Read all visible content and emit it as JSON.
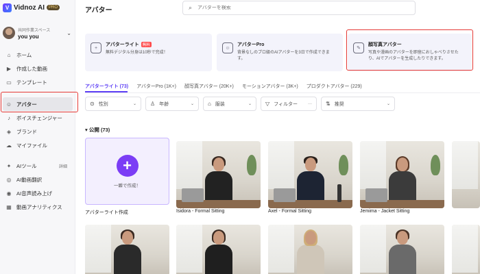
{
  "app": {
    "logo_text": "Vidnoz AI",
    "plan_badge": "PRO"
  },
  "workspace": {
    "label": "共同作業スペース",
    "name": "you you"
  },
  "sidebar": {
    "items": [
      {
        "label": "ホーム",
        "icon": "home-icon"
      },
      {
        "label": "作成した動画",
        "icon": "video-icon"
      },
      {
        "label": "テンプレート",
        "icon": "template-icon"
      },
      {
        "label": "アバター",
        "icon": "avatar-icon",
        "active": true
      },
      {
        "label": "ボイスチェンジャー",
        "icon": "voice-icon"
      },
      {
        "label": "ブランド",
        "icon": "brand-icon"
      },
      {
        "label": "マイファイル",
        "icon": "cloud-icon"
      }
    ],
    "tools": [
      {
        "label": "AIツール",
        "icon": "ai-tools-icon",
        "more": "詳細"
      },
      {
        "label": "AI動画翻訳",
        "icon": "translate-icon"
      },
      {
        "label": "AI音声読み上げ",
        "icon": "tts-icon"
      },
      {
        "label": "動画アナリティクス",
        "icon": "analytics-icon"
      }
    ]
  },
  "header": {
    "title": "アバター",
    "search_placeholder": "アバターを検索"
  },
  "features": [
    {
      "title": "アバターライト",
      "badge": "無料",
      "desc": "無料デジタル分身は10秒で完成！"
    },
    {
      "title": "アバターPro",
      "desc": "背景なしのプロ級のAIアバターを3日で作成できます。"
    },
    {
      "title": "顔写真アバター",
      "desc": "写真や漫画のアバターを即座におしゃべりさせたり、AIでアバターを生成したりできます。"
    }
  ],
  "tabs": [
    {
      "label": "アバターライト (73)",
      "active": true
    },
    {
      "label": "アバターPro (1K+)"
    },
    {
      "label": "顔写真アバター (20K+)"
    },
    {
      "label": "モーションアバター (3K+)"
    },
    {
      "label": "プロダクトアバター (229)"
    }
  ],
  "filters": [
    {
      "label": "性別",
      "icon": "gender-icon",
      "caret": true
    },
    {
      "label": "年齢",
      "icon": "age-icon",
      "caret": true
    },
    {
      "label": "服装",
      "icon": "clothing-icon",
      "caret": true
    },
    {
      "label": "フィルター",
      "icon": "filter-icon",
      "dots": "···"
    },
    {
      "label": "推奨",
      "icon": "sort-icon",
      "caret": true
    }
  ],
  "section": {
    "title": "公開 (73)"
  },
  "create_card": {
    "label": "一瞬で作成！",
    "caption": "アバターライト作成"
  },
  "avatars": [
    {
      "name": "Isidora - Formal Sitting"
    },
    {
      "name": "Axel - Formal Sitting"
    },
    {
      "name": "Jemima - Jacket Sitting"
    }
  ]
}
